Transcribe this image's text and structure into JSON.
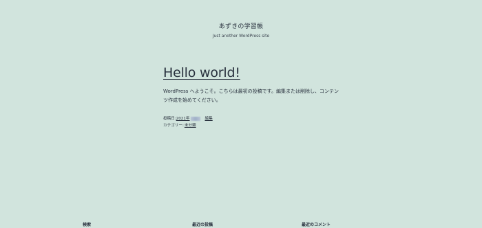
{
  "site": {
    "title": "あずきの学習帳",
    "tagline": "Just another WordPress site"
  },
  "post": {
    "title": "Hello world!",
    "content": "WordPress へようこそ。こちらは最初の投稿です。編集または削除し、コンテンツ作成を始めてください。",
    "meta": {
      "posted_on_label": "投稿日:",
      "date_visible": "2021年",
      "edit_label": "編集",
      "category_label": "カテゴリー:",
      "category": "未分類"
    }
  },
  "widgets": {
    "search_title": "検索",
    "recent_posts_title": "最近の投稿",
    "recent_comments_title": "最近のコメント"
  },
  "colors": {
    "background": "#d1e4dd",
    "text": "#28303d"
  }
}
